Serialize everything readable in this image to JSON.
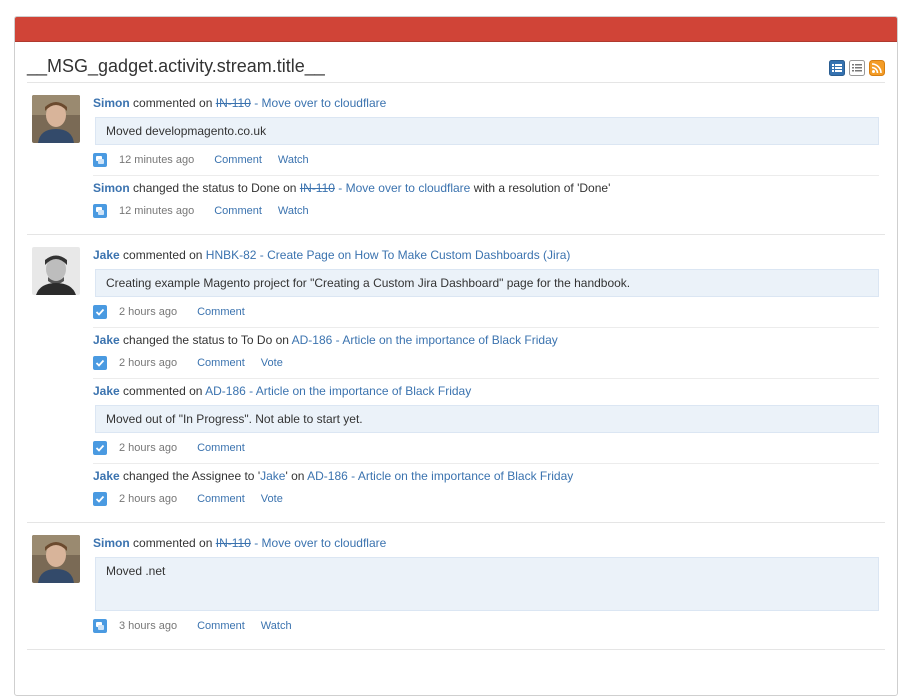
{
  "header": {
    "title": "__MSG_gadget.activity.stream.title__"
  },
  "header_icons": [
    "full-view-icon",
    "list-view-icon",
    "rss-feed-icon"
  ],
  "colors": {
    "bar": "#d04437",
    "link": "#3b73af",
    "comment_bg": "#ebf2f9"
  },
  "groups": [
    {
      "user": "Simon",
      "items": [
        {
          "user": "Simon",
          "verb": "commented on",
          "issue_key": "IN-110",
          "issue_title": " - Move over to cloudflare",
          "comment": "Moved developmagento.co.uk",
          "time": "12 minutes ago",
          "action1": "Comment",
          "action2": "Watch"
        },
        {
          "user": "Simon",
          "verb": "changed the status to Done on",
          "issue_key": "IN-110",
          "issue_title": " - Move over to cloudflare",
          "suffix": "with a resolution of 'Done'",
          "time": "12 minutes ago",
          "action1": "Comment",
          "action2": "Watch"
        }
      ]
    },
    {
      "user": "Jake",
      "items": [
        {
          "user": "Jake",
          "verb": "commented on",
          "issue_link": "HNBK-82 - Create Page on How To Make Custom Dashboards (Jira)",
          "comment": "Creating example Magento project for \"Creating a Custom Jira Dashboard\" page for the handbook.",
          "time": "2 hours ago",
          "action1": "Comment"
        },
        {
          "user": "Jake",
          "verb": "changed the status to To Do on",
          "issue_link": "AD-186 - Article on the importance of Black Friday",
          "time": "2 hours ago",
          "action1": "Comment",
          "action2": "Vote"
        },
        {
          "user": "Jake",
          "verb": "commented on",
          "issue_link": "AD-186 - Article on the importance of Black Friday",
          "comment": "Moved out of \"In Progress\". Not able to start yet.",
          "time": "2 hours ago",
          "action1": "Comment"
        },
        {
          "user": "Jake",
          "verb": "changed the Assignee to '",
          "assignee": "Jake",
          "verb2": "' on",
          "issue_link": "AD-186 - Article on the importance of Black Friday",
          "time": "2 hours ago",
          "action1": "Comment",
          "action2": "Vote"
        }
      ]
    },
    {
      "user": "Simon",
      "items": [
        {
          "user": "Simon",
          "verb": "commented on",
          "issue_key": "IN-110",
          "issue_title": " - Move over to cloudflare",
          "comment": "Moved .net",
          "time": "3 hours ago",
          "action1": "Comment",
          "action2": "Watch"
        }
      ]
    }
  ]
}
